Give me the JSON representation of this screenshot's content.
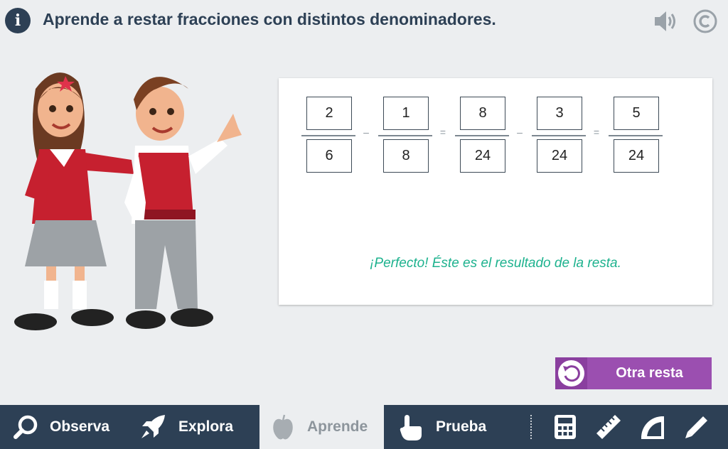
{
  "header": {
    "info_icon_glyph": "i",
    "title": "Aprende a restar fracciones con distintos denominadores.",
    "icons": [
      "info-icon",
      "sound-icon",
      "copyright-icon"
    ]
  },
  "exercise": {
    "fractions": [
      {
        "numerator": "2",
        "denominator": "6"
      },
      {
        "numerator": "1",
        "denominator": "8"
      },
      {
        "numerator": "8",
        "denominator": "24"
      },
      {
        "numerator": "3",
        "denominator": "24"
      },
      {
        "numerator": "5",
        "denominator": "24"
      }
    ],
    "operators": [
      "–",
      "=",
      "–",
      "="
    ],
    "feedback": "¡Perfecto! Éste es el resultado de la resta."
  },
  "actions": {
    "redo_label": "Otra resta",
    "redo_icon": "rotate-ccw-icon"
  },
  "nav": {
    "items": [
      {
        "label": "Observa",
        "icon": "magnifier-icon"
      },
      {
        "label": "Explora",
        "icon": "rocket-icon"
      },
      {
        "label": "Aprende",
        "icon": "apple-icon",
        "active": true
      },
      {
        "label": "Prueba",
        "icon": "pointing-hand-icon"
      }
    ],
    "tools": [
      "calculator-icon",
      "ruler-icon",
      "protractor-icon",
      "pencil-icon"
    ]
  },
  "colors": {
    "navy": "#2d4055",
    "background": "#eceef0",
    "feedback_green": "#1db28e",
    "button_purple": "#9b4fb0"
  }
}
